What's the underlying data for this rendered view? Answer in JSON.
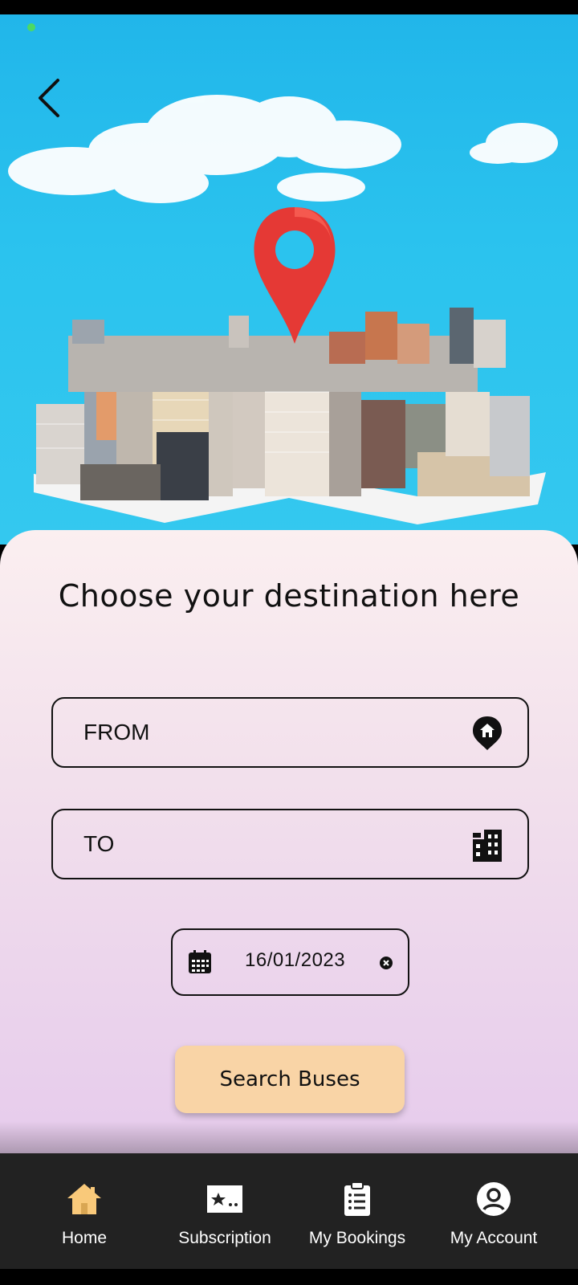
{
  "header": {
    "back_icon": "chevron-left-icon"
  },
  "hero": {
    "image": "city-with-location-pin-illustration",
    "colors": {
      "sky": "#2bc3ee",
      "pin": "#e53935"
    }
  },
  "main": {
    "title": "Choose your destination here",
    "from_field": {
      "label": "FROM",
      "icon": "home-pin-icon"
    },
    "to_field": {
      "label": "TO",
      "icon": "buildings-icon"
    },
    "date_field": {
      "value": "16/01/2023",
      "icon": "calendar-icon",
      "clear_icon": "clear-icon"
    },
    "search_button": {
      "label": "Search Buses",
      "color": "#f9d4a6"
    }
  },
  "nav": {
    "items": [
      {
        "label": "Home",
        "icon": "home-icon",
        "active": true,
        "color": "#f9c97a"
      },
      {
        "label": "Subscription",
        "icon": "subscription-card-icon",
        "active": false
      },
      {
        "label": "My Bookings",
        "icon": "clipboard-list-icon",
        "active": false
      },
      {
        "label": "My Account",
        "icon": "account-circle-icon",
        "active": false
      }
    ]
  }
}
